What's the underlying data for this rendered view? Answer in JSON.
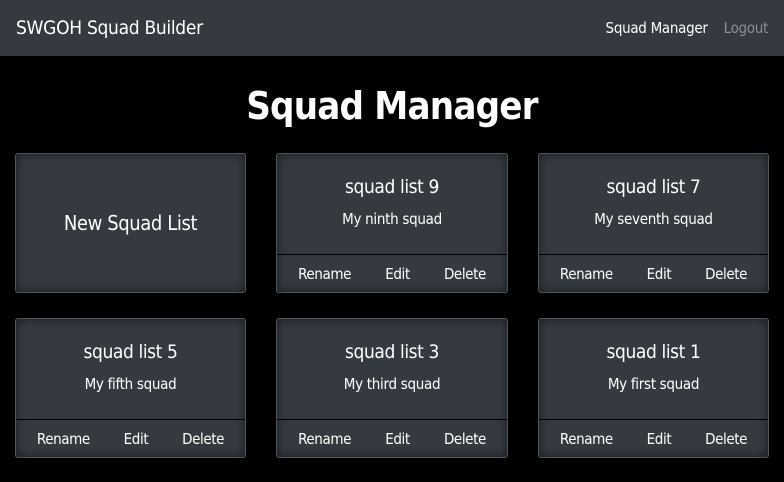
{
  "navbar": {
    "brand": "SWGOH Squad Builder",
    "links": [
      "Squad Manager",
      "Logout"
    ]
  },
  "page": {
    "title": "Squad Manager",
    "new_card_label": "New Squad List"
  },
  "actions": {
    "rename": "Rename",
    "edit": "Edit",
    "delete": "Delete"
  },
  "squads": [
    {
      "name": "squad list 9",
      "description": "My ninth squad"
    },
    {
      "name": "squad list 7",
      "description": "My seventh squad"
    },
    {
      "name": "squad list 5",
      "description": "My fifth squad"
    },
    {
      "name": "squad list 3",
      "description": "My third squad"
    },
    {
      "name": "squad list 1",
      "description": "My first squad"
    }
  ],
  "colors": {
    "navbar_bg": "#343a40",
    "card_bg": "#343a40",
    "page_bg": "#000000",
    "muted_link": "#8a8f94"
  }
}
